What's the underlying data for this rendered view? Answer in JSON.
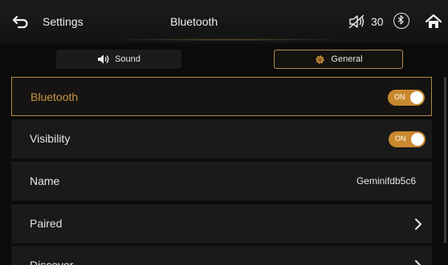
{
  "header": {
    "back_label": "Settings",
    "title": "Bluetooth",
    "volume_value": "30",
    "icons": {
      "back": "back-arrow-icon",
      "volume": "volume-muted-icon",
      "bluetooth": "bluetooth-icon",
      "home": "home-icon"
    }
  },
  "tabs": [
    {
      "label": "Sound",
      "icon": "speaker-icon",
      "active": false
    },
    {
      "label": "General",
      "icon": "gear-icon",
      "active": true
    }
  ],
  "settings": [
    {
      "label": "Bluetooth",
      "toggle": "ON",
      "selected": true
    },
    {
      "label": "Visibility",
      "toggle": "ON"
    },
    {
      "label": "Name",
      "value": "Geminifdb5c6"
    },
    {
      "label": "Paired"
    },
    {
      "label": "Discover"
    }
  ],
  "colors": {
    "accent": "#b48a4a",
    "toggle_on": "#c9882e",
    "background": "#0b0b0b",
    "row": "#1a1a1a"
  }
}
